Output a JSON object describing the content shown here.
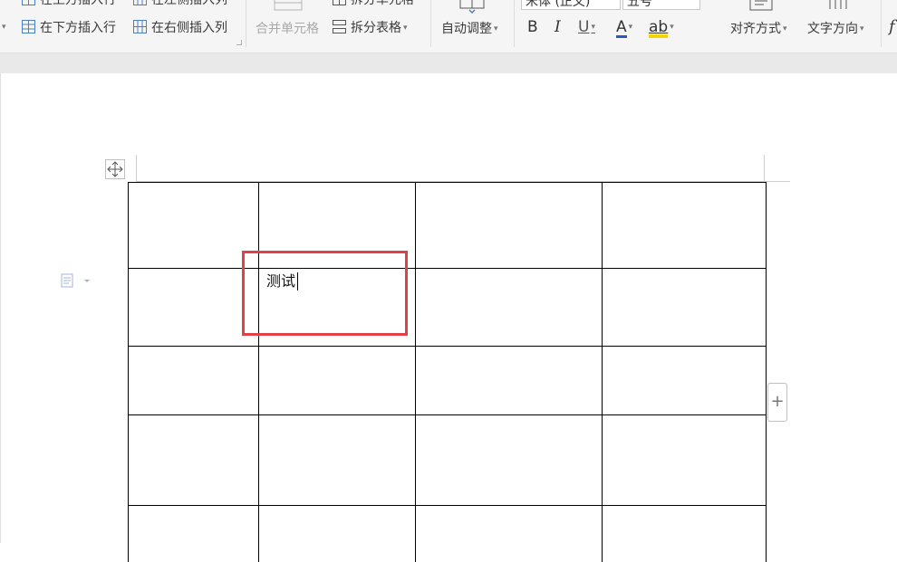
{
  "ribbon": {
    "partial_left_label": "",
    "insert_above": "在上方插入行",
    "insert_left": "在左侧插入列",
    "insert_below": "在下方插入行",
    "insert_right": "在右侧插入列",
    "merge_cells": "合并单元格",
    "split_cells": "拆分单元格",
    "split_table": "拆分表格",
    "auto_fit": "自动调整",
    "font_name": "宋体 (正文)",
    "font_size": "五号",
    "bold": "B",
    "italic": "I",
    "underline": "U",
    "font_color": "A",
    "highlight": "ab",
    "align": "对齐方式",
    "text_direction": "文字方向",
    "formula_glyph": "f"
  },
  "document": {
    "cell_text": "测试"
  },
  "icons": {
    "table_move_handle": "move-arrows-icon",
    "paragraph_mark": "paragraph-layout-icon",
    "add_column": "plus-icon"
  },
  "colors": {
    "highlight_border": "#e04046",
    "font_color_underline": "#2b59c3",
    "highlight_color": "#f2d600",
    "icon_blue": "#4a7fc1"
  },
  "table": {
    "rows": 5,
    "columns": 4
  }
}
